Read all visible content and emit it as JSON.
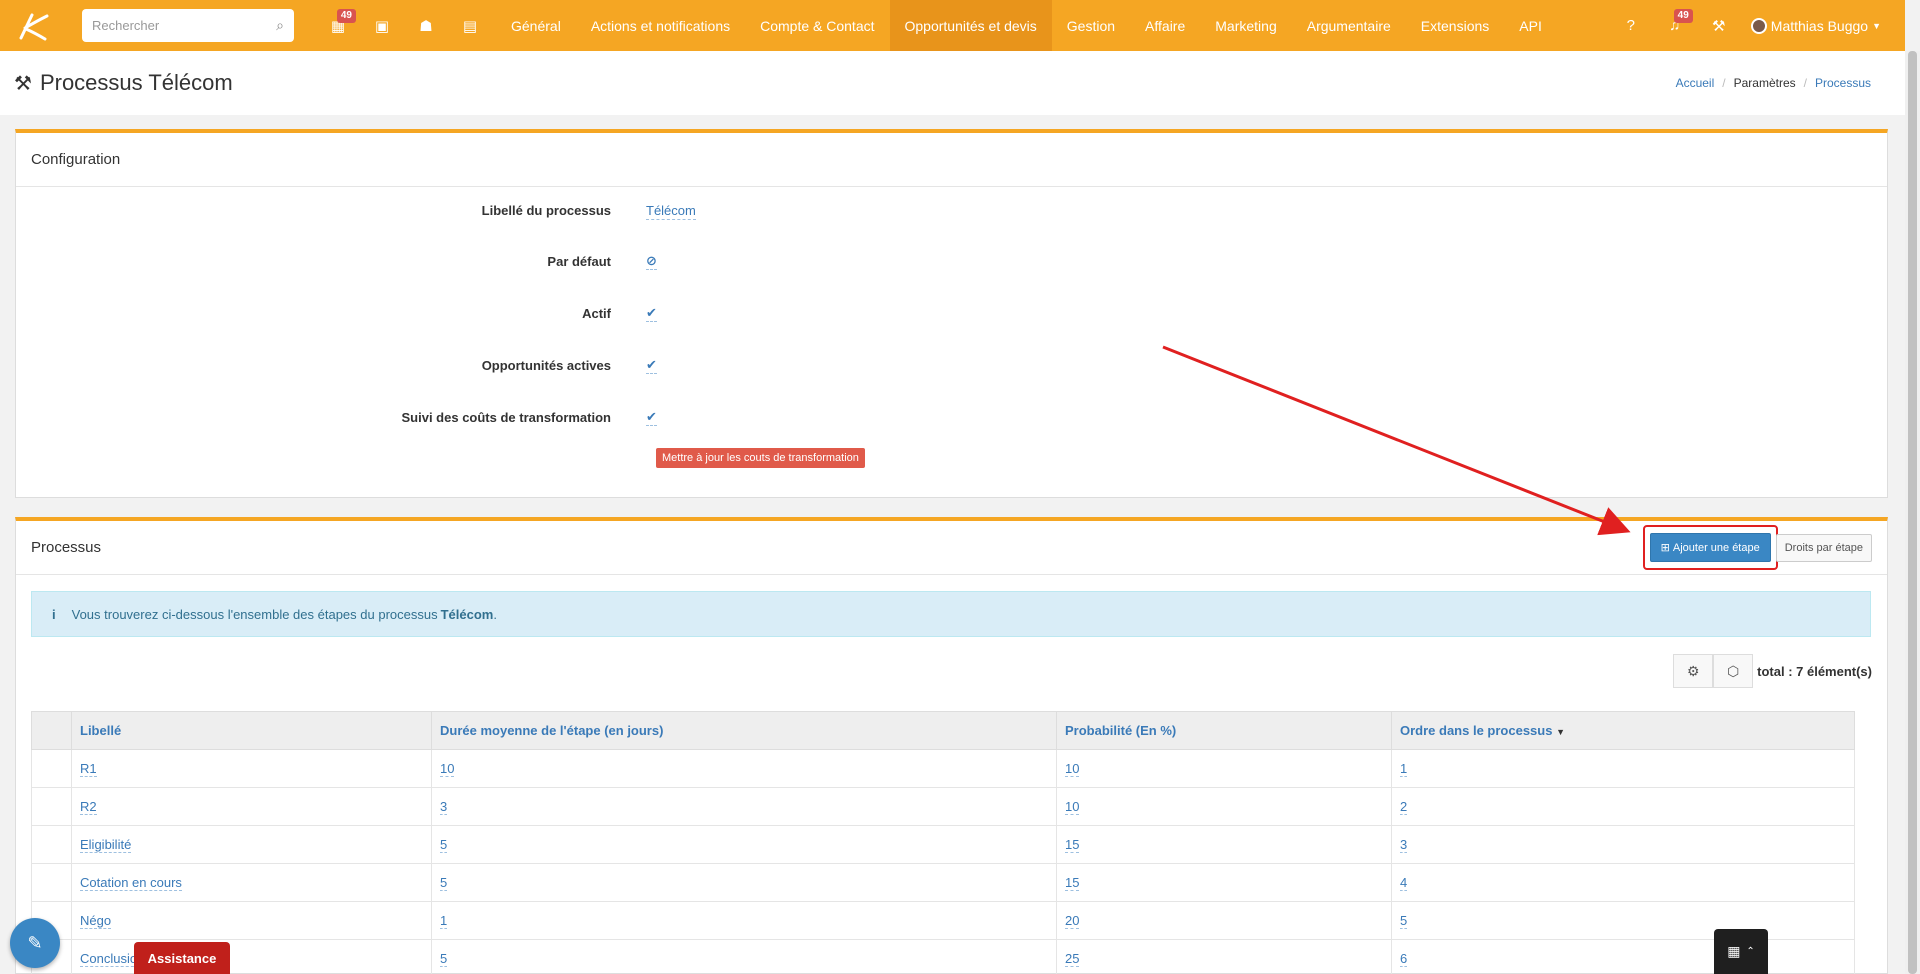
{
  "topbar": {
    "search_placeholder": "Rechercher",
    "nav_icons": [
      {
        "name": "calendar-icon",
        "badge": "49"
      },
      {
        "name": "money-icon",
        "badge": ""
      },
      {
        "name": "users-icon",
        "badge": ""
      },
      {
        "name": "document-icon",
        "badge": ""
      }
    ],
    "menu": [
      {
        "label": "Général",
        "active": false
      },
      {
        "label": "Actions et notifications",
        "active": false
      },
      {
        "label": "Compte & Contact",
        "active": false
      },
      {
        "label": "Opportunités et devis",
        "active": true
      },
      {
        "label": "Gestion",
        "active": false
      },
      {
        "label": "Affaire",
        "active": false
      },
      {
        "label": "Marketing",
        "active": false
      },
      {
        "label": "Argumentaire",
        "active": false
      },
      {
        "label": "Extensions",
        "active": false
      },
      {
        "label": "API",
        "active": false
      }
    ],
    "notifications_badge": "49",
    "user_name": "Matthias Buggo"
  },
  "header": {
    "title": "Processus Télécom",
    "breadcrumb": [
      "Accueil",
      "Paramètres",
      "Processus"
    ]
  },
  "config": {
    "heading": "Configuration",
    "rows": [
      {
        "label": "Libellé du processus",
        "value": "Télécom"
      },
      {
        "label": "Par défaut",
        "value": "⊘"
      },
      {
        "label": "Actif",
        "value": "✔"
      },
      {
        "label": "Opportunités actives",
        "value": "✔"
      },
      {
        "label": "Suivi des coûts de transformation",
        "value": "✔"
      }
    ],
    "update_button": "Mettre à jour les couts de transformation"
  },
  "process": {
    "heading": "Processus",
    "add_step_button": "Ajouter une étape",
    "rights_button": "Droits par étape",
    "alert_prefix": "Vous trouverez ci-dessous l'ensemble des étapes du processus ",
    "alert_bold": "Télécom",
    "alert_suffix": ".",
    "total": "total : 7 élément(s)",
    "columns": [
      "Libellé",
      "Durée moyenne de l'étape (en jours)",
      "Probabilité (En %)",
      "Ordre dans le processus"
    ],
    "rows": [
      {
        "label": "R1",
        "duration": "10",
        "probability": "10",
        "order": "1"
      },
      {
        "label": "R2",
        "duration": "3",
        "probability": "10",
        "order": "2"
      },
      {
        "label": "Eligibilité",
        "duration": "5",
        "probability": "15",
        "order": "3"
      },
      {
        "label": "Cotation en cours",
        "duration": "5",
        "probability": "15",
        "order": "4"
      },
      {
        "label": "Négo",
        "duration": "1",
        "probability": "20",
        "order": "5"
      },
      {
        "label": "Conclusion",
        "duration": "5",
        "probability": "25",
        "order": "6"
      }
    ]
  },
  "floating": {
    "assistance": "Assistance"
  },
  "colors": {
    "brand": "#f5a623",
    "active_menu": "#e8941b",
    "link": "#3a7ab8",
    "danger": "#e05a4a",
    "annotation_arrow": "#e02020"
  }
}
